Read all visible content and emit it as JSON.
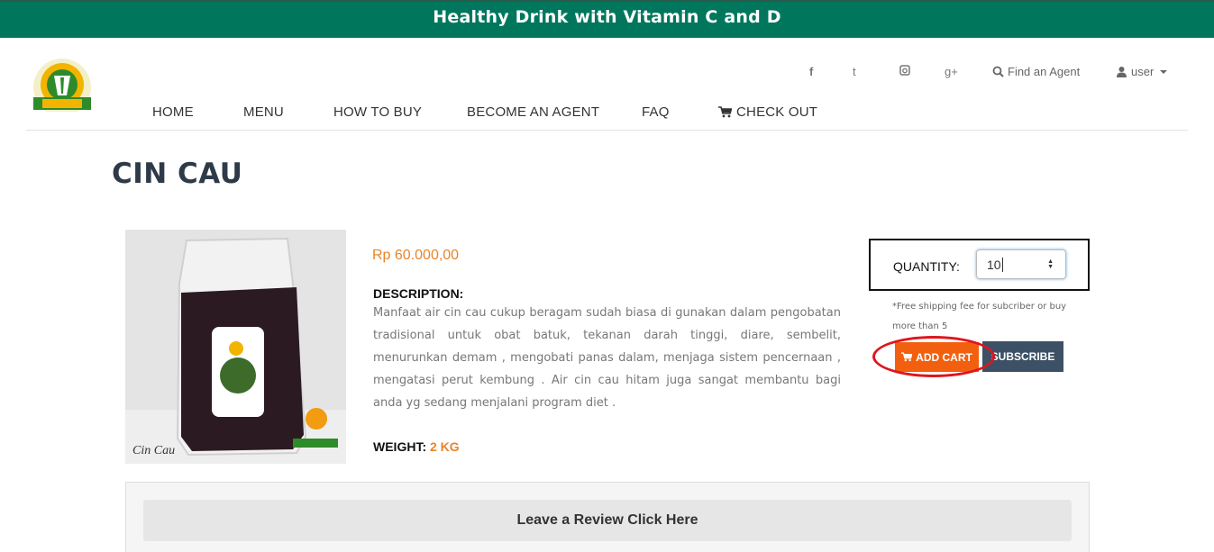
{
  "banner": {
    "text": "Healthy Drink with Vitamin C and D"
  },
  "brand": {
    "logo_icon": "leaf-cup-logo-icon"
  },
  "header": {
    "social": {
      "facebook": "f",
      "twitter": "t",
      "instagram": "◘",
      "googleplus": "g+"
    },
    "find_agent": "Find an Agent",
    "user": "user"
  },
  "nav": {
    "home": "HOME",
    "menu": "MENU",
    "how_to_buy": "HOW TO BUY",
    "become_agent": "BECOME AN AGENT",
    "faq": "FAQ",
    "checkout": "CHECK OUT"
  },
  "product": {
    "title": "CIN CAU",
    "image_caption": "Cin Cau",
    "price": "Rp 60.000,00",
    "description_label": "DESCRIPTION:",
    "description": "Manfaat air cin cau cukup beragam sudah biasa di gunakan dalam pengobatan tradisional untuk obat batuk, tekanan darah tinggi, diare, sembelit, menurunkan demam , mengobati panas dalam, menjaga sistem pencernaan , mengatasi perut kembung . Air cin cau hitam juga sangat membantu bagi anda yg sedang menjalani program diet .",
    "weight_label": "WEIGHT:",
    "weight_value": "2 KG"
  },
  "purchase": {
    "quantity_label": "QUANTITY:",
    "quantity_value": "10",
    "shipping_note": "*Free shipping fee for subcriber or buy more than 5",
    "add_cart": "ADD CART",
    "subscribe": "SUBSCRIBE"
  },
  "review": {
    "button": "Leave a Review Click Here"
  },
  "colors": {
    "banner": "#00775d",
    "accent": "#e8842a",
    "add_cart": "#f2600f",
    "subscribe": "#3d5166",
    "highlight": "#e0141c"
  }
}
